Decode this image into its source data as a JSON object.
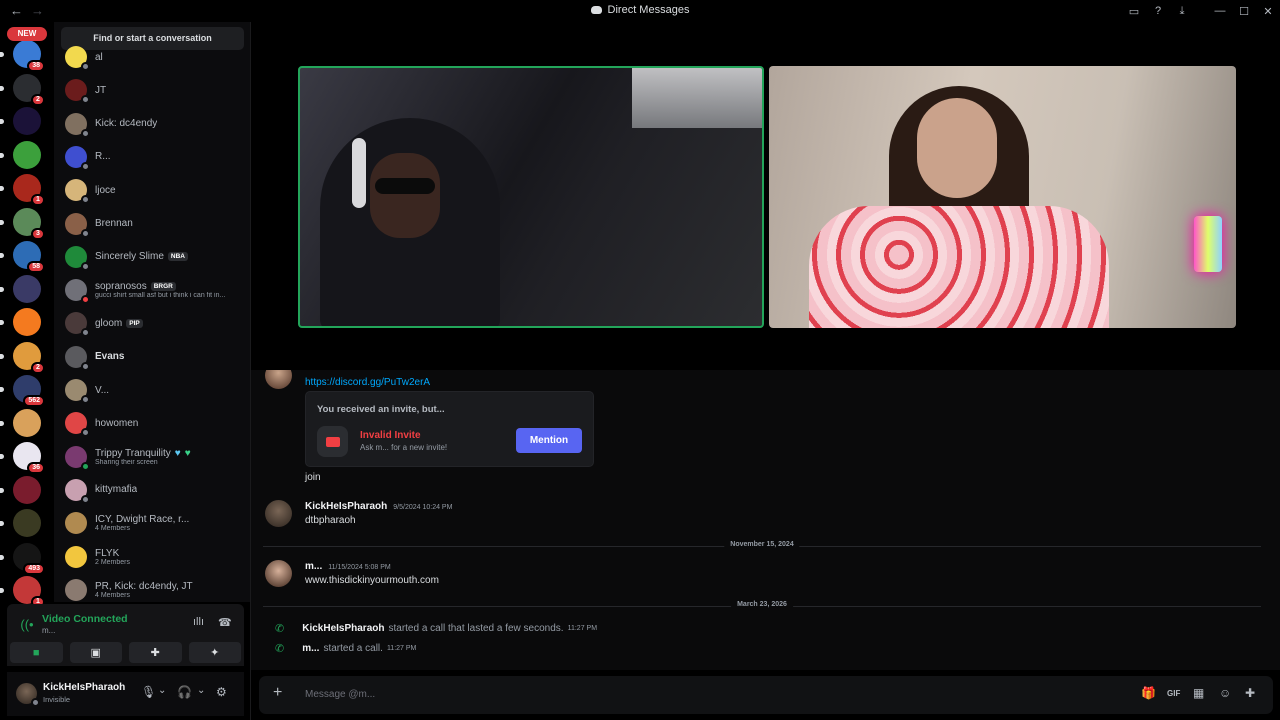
{
  "titlebar": {
    "back": "←",
    "forward": "→",
    "title": "Direct Messages",
    "inbox_icon": "▭",
    "help_icon": "?",
    "download_icon": "⤓",
    "minimize": "—",
    "maximize": "☐",
    "close": "✕"
  },
  "rail": {
    "new_badge": "NEW",
    "servers": [
      {
        "badge": "38",
        "color": "#3a7bd5"
      },
      {
        "badge": "2",
        "color": "#2b2d31"
      },
      {
        "badge": "",
        "color": "#1b1238"
      },
      {
        "badge": "",
        "color": "#3ca03c"
      },
      {
        "badge": "1",
        "color": "#a9281c"
      },
      {
        "badge": "3",
        "color": "#5b8a59"
      },
      {
        "badge": "58",
        "color": "#2d6cb5"
      },
      {
        "badge": "",
        "color": "#3a3a66"
      },
      {
        "badge": "",
        "color": "#f47a1f"
      },
      {
        "badge": "2",
        "color": "#e09b3d"
      },
      {
        "badge": "562",
        "color": "#2f3d6b"
      },
      {
        "badge": "",
        "color": "#d9a15b"
      },
      {
        "badge": "36",
        "color": "#e9e6f0"
      },
      {
        "badge": "",
        "color": "#7a1c2d"
      },
      {
        "badge": "",
        "color": "#3a3a22"
      },
      {
        "badge": "493",
        "color": "#151515"
      },
      {
        "badge": "1",
        "color": "#c33838"
      }
    ]
  },
  "sidebar": {
    "search_label": "Find or start a conversation",
    "dms": [
      {
        "name": "al",
        "sub": "",
        "color": "#f2d94e",
        "status": "gray",
        "bold": false,
        "tag": "",
        "heart": false
      },
      {
        "name": "JT",
        "sub": "",
        "color": "#6b1c1c",
        "status": "gray",
        "bold": false,
        "tag": "",
        "heart": false
      },
      {
        "name": "Kick: dc4endy",
        "sub": "",
        "color": "#807060",
        "status": "gray",
        "bold": false,
        "tag": "",
        "heart": false
      },
      {
        "name": "R...",
        "sub": "",
        "color": "#3f4fd0",
        "status": "gray",
        "bold": false,
        "tag": "",
        "heart": false
      },
      {
        "name": "ljoce",
        "sub": "",
        "color": "#d6b57a",
        "status": "gray",
        "bold": false,
        "tag": "",
        "heart": false
      },
      {
        "name": "Brennan",
        "sub": "",
        "color": "#8a6048",
        "status": "gray",
        "bold": false,
        "tag": "",
        "heart": false
      },
      {
        "name": "Sincerely Slime",
        "sub": "",
        "color": "#1f8a3a",
        "status": "gray",
        "bold": false,
        "tag": "NBA",
        "heart": false
      },
      {
        "name": "sopranosos",
        "sub": "gucci shirt small asf but i think i can fit in...",
        "color": "#707078",
        "status": "red",
        "bold": false,
        "tag": "BRGR",
        "heart": false
      },
      {
        "name": "gloom",
        "sub": "",
        "color": "#4a3a3a",
        "status": "gray",
        "bold": false,
        "tag": "PIP",
        "heart": false
      },
      {
        "name": "Evans",
        "sub": "",
        "color": "#5a5a5e",
        "status": "gray",
        "bold": true,
        "tag": "",
        "heart": false
      },
      {
        "name": "V...",
        "sub": "",
        "color": "#9a8a70",
        "status": "gray",
        "bold": false,
        "tag": "",
        "heart": false
      },
      {
        "name": "howomen",
        "sub": "",
        "color": "#e04646",
        "status": "gray",
        "bold": false,
        "tag": "",
        "heart": false
      },
      {
        "name": "Trippy Tranquility",
        "sub": "Sharing their screen",
        "color": "#7a3a70",
        "status": "green",
        "bold": false,
        "tag": "",
        "heart": true
      },
      {
        "name": "kittymafia",
        "sub": "",
        "color": "#c8a0b0",
        "status": "gray",
        "bold": false,
        "tag": "",
        "heart": false
      },
      {
        "name": "ICY, Dwight Race, r...",
        "sub": "4 Members",
        "color": "#b08a50",
        "status": "",
        "bold": false,
        "tag": "",
        "heart": false
      },
      {
        "name": "FLYK",
        "sub": "2 Members",
        "color": "#f2c63e",
        "status": "",
        "bold": false,
        "tag": "",
        "heart": false
      },
      {
        "name": "PR, Kick: dc4endy, JT",
        "sub": "4 Members",
        "color": "#8a7a70",
        "status": "",
        "bold": false,
        "tag": "",
        "heart": false
      }
    ]
  },
  "voice": {
    "status": "Video Connected",
    "channel": "m...",
    "signal_icon": "((•",
    "waveform_icon": "ıllı",
    "disconnect_icon": "☎",
    "camera_icon": "■",
    "screen_icon": "▣",
    "activity_icon": "✚",
    "soundboard_icon": "✦"
  },
  "user": {
    "name": "KickHeIsPharaoh",
    "status": "Invisible",
    "mic_icon": "🎙",
    "chevron1": "⌄",
    "headset_icon": "🎧",
    "chevron2": "⌄",
    "settings_icon": "⚙"
  },
  "chat": {
    "link": "https://discord.gg/PuTw2erA",
    "invite_heading": "You received an invite, but...",
    "invite_title": "Invalid Invite",
    "invite_sub": "Ask m... for a new invite!",
    "invite_button": "Mention",
    "join_text": "join",
    "msg1_author": "KickHeIsPharaoh",
    "msg1_time": "9/5/2024 10:24 PM",
    "msg1_text": "dtbpharaoh",
    "divider1": "November 15, 2024",
    "msg2_author": "m...",
    "msg2_time": "11/15/2024 5:08 PM",
    "msg2_text": "www.thisdickinyourmouth.com",
    "divider2": "March 23, 2026",
    "call1_author": "KickHeIsPharaoh",
    "call1_text": "started a call that lasted a few seconds.",
    "call1_time": "11:27 PM",
    "call2_author": "m...",
    "call2_text": "started a call.",
    "call2_time": "11:27 PM"
  },
  "composer": {
    "placeholder": "Message @m...",
    "plus_icon": "+",
    "gift_icon": "🎁",
    "gif_icon": "GIF",
    "sticker_icon": "▦",
    "emoji_icon": "☺",
    "apps_icon": "✚"
  }
}
